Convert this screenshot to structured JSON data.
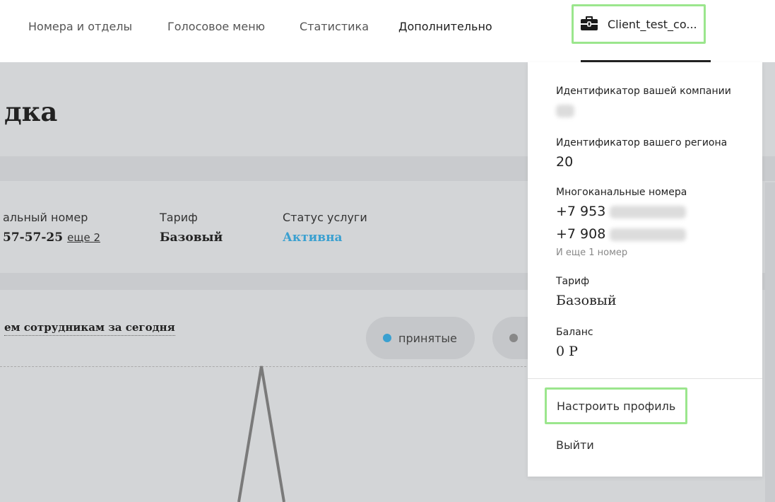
{
  "nav": {
    "items": [
      {
        "label": "Номера и отделы"
      },
      {
        "label": "Голосовое меню"
      },
      {
        "label": "Статистика"
      },
      {
        "label": "Дополнительно"
      }
    ],
    "account": {
      "label": "Client_test_co..."
    }
  },
  "page": {
    "title": "дка",
    "info": {
      "number_label": "альный номер",
      "number_value": "57-57-25",
      "number_more": "еще 2",
      "tariff_label": "Тариф",
      "tariff_value": "Базовый",
      "status_label": "Статус услуги",
      "status_value": "Активна"
    },
    "chart_title": "ем сотрудникам за сегодня",
    "legend": [
      {
        "label": "принятые",
        "color": "#3aa0d0"
      },
      {
        "label": "",
        "color": "#888888"
      }
    ]
  },
  "dropdown": {
    "company_id_label": "Идентификатор вашей компании",
    "region_id_label": "Идентификатор вашего региона",
    "region_id_value": "20",
    "multichannel_label": "Многоканальные номера",
    "phones": [
      "+7 953",
      "+7 908"
    ],
    "more_numbers": "И еще 1 номер",
    "tariff_label": "Тариф",
    "tariff_value": "Базовый",
    "balance_label": "Баланс",
    "balance_value": "0 Р",
    "profile_link": "Настроить профиль",
    "logout_link": "Выйти"
  },
  "colors": {
    "accent_green": "#9be68d",
    "status_blue": "#3aa0d0",
    "overlay_gray": "#d3d5d7"
  }
}
